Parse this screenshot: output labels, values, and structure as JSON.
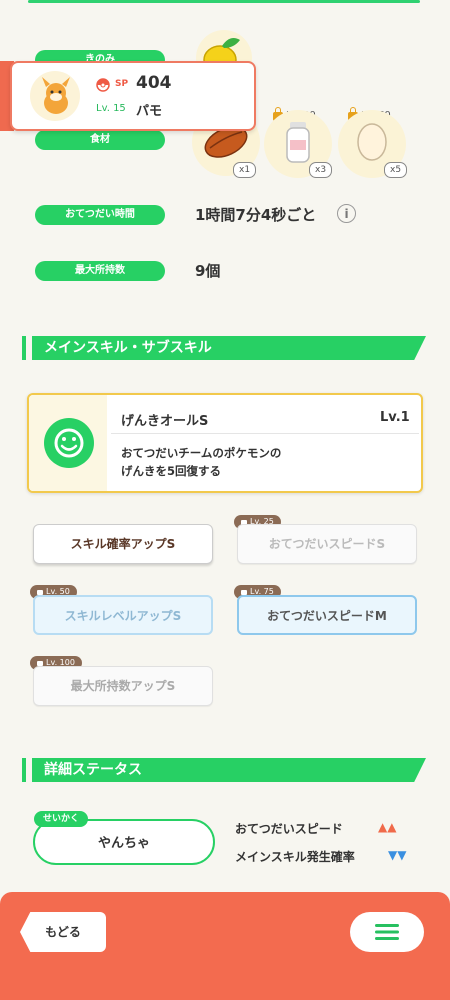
{
  "profile": {
    "sp_label": "SP",
    "sp_value": "404",
    "level": "Lv. 15",
    "name": "パモ"
  },
  "rows": {
    "berry_label": "きのみ",
    "ingredients_label": "食材",
    "help_time_label": "おてつだい時間",
    "help_time_value": "1時間7分4秒ごと",
    "max_carry_label": "最大所持数",
    "max_carry_value": "9個"
  },
  "ingredients": [
    {
      "icon": "cacao-icon",
      "lv": "",
      "count": "x1"
    },
    {
      "icon": "milk-bottle-icon",
      "lv": "Lv. 30",
      "count": "x3"
    },
    {
      "icon": "egg-icon",
      "lv": "Lv. 60",
      "count": "x5"
    }
  ],
  "sections": {
    "skills_title": "メインスキル・サブスキル",
    "details_title": "詳細ステータス"
  },
  "main_skill": {
    "name": "げんきオールS",
    "level": "Lv.1",
    "desc_line1": "おてつだいチームのポケモンの",
    "desc_line2": "げんきを5回復する"
  },
  "sub_skills": [
    {
      "label": "スキル確率アップS",
      "lv": ""
    },
    {
      "label": "おてつだいスピードS",
      "lv": "Lv. 25"
    },
    {
      "label": "スキルレベルアップS",
      "lv": "Lv. 50"
    },
    {
      "label": "おてつだいスピードM",
      "lv": "Lv. 75"
    },
    {
      "label": "最大所持数アップS",
      "lv": "Lv. 100"
    }
  ],
  "nature": {
    "tag": "せいかく",
    "value": "やんちゃ",
    "up_label": "おてつだいスピード",
    "up_mark": "▲▲",
    "down_label": "メインスキル発生確率",
    "down_mark": "▼▼"
  },
  "nav": {
    "back_label": "もどる",
    "menu_icon": "hamburger-icon"
  },
  "colors": {
    "accent_green": "#27d064",
    "accent_orange": "#f36b4f",
    "up_color": "#f06a4a",
    "down_color": "#3a8fe0"
  }
}
